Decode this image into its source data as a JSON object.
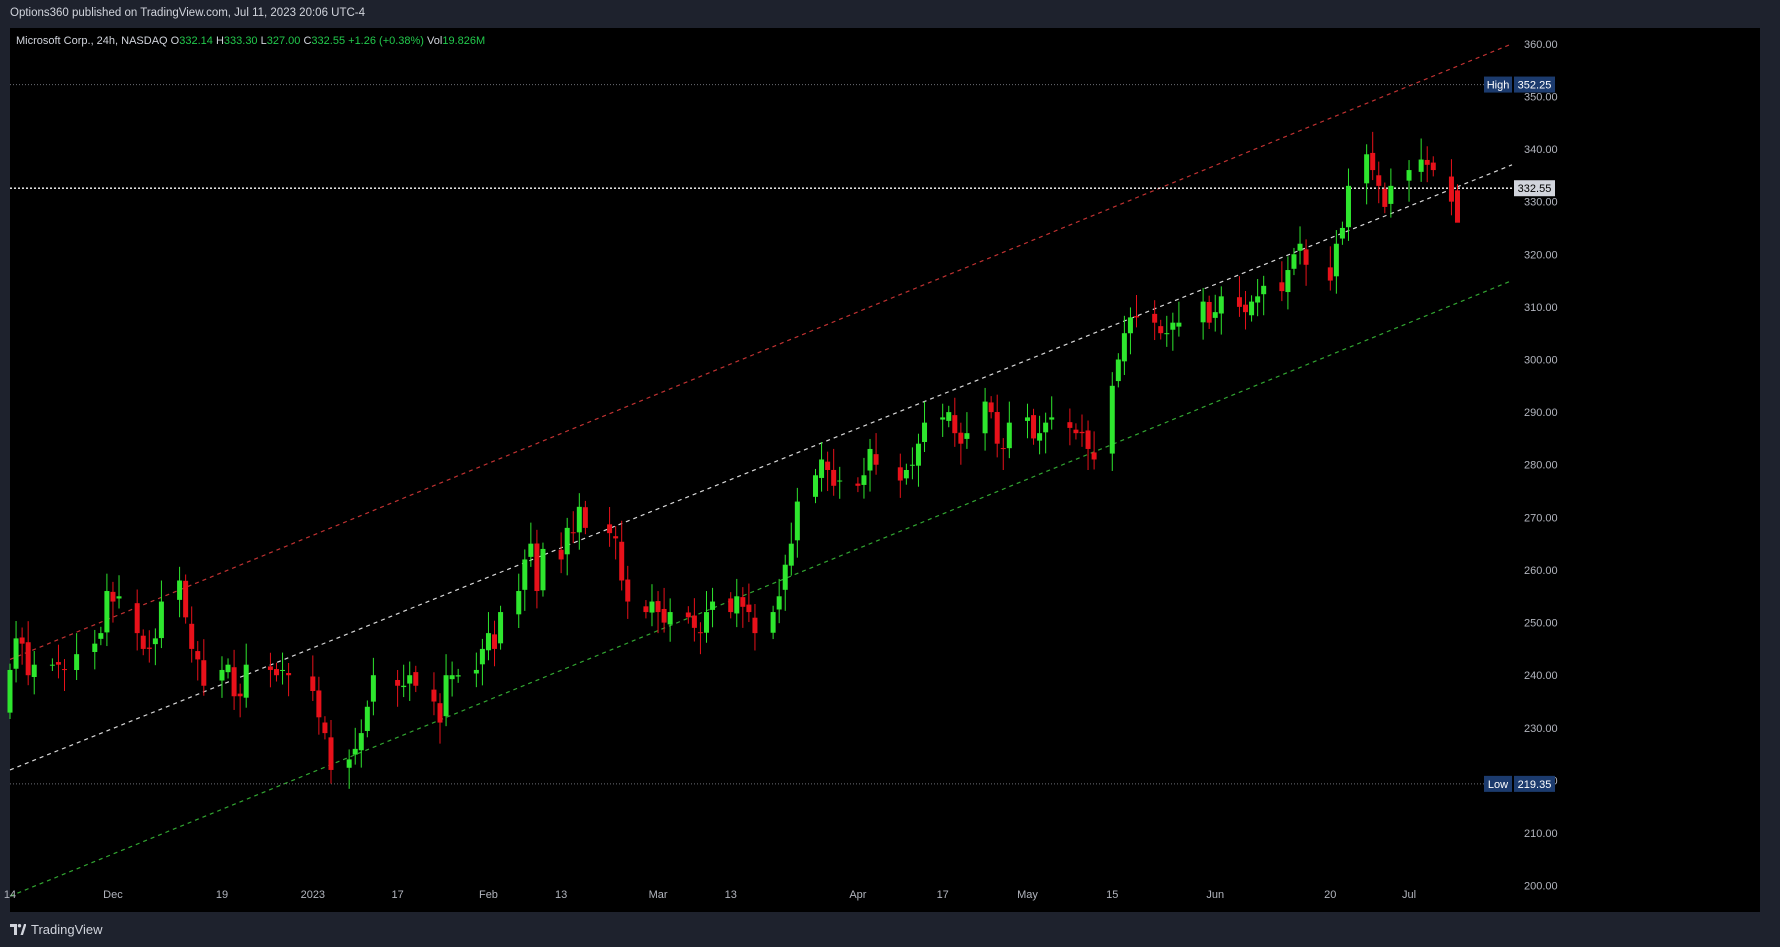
{
  "header": {
    "published": "Options360 published on TradingView.com, Jul 11, 2023 20:06 UTC-4"
  },
  "legend": {
    "symbol": "Microsoft Corp., 24h, NASDAQ",
    "open_label": "O",
    "open": "332.14",
    "high_label": "H",
    "high": "333.30",
    "low_label": "L",
    "low": "327.00",
    "close_label": "C",
    "close": "332.55",
    "change": "+1.26 (+0.38%)",
    "vol_label": "Vol",
    "volume": "19.826M"
  },
  "footer": {
    "brand": "TradingView"
  },
  "colors": {
    "up": "#2ee62e",
    "down": "#e8111a",
    "background": "#000000",
    "panel": "#1e222d",
    "axis_text": "#b2b5be",
    "upper_channel": "#e23b3b",
    "middle_channel": "#ffffff",
    "lower_channel": "#3bc43b",
    "badge": "#1c3b6e"
  },
  "chart_data": {
    "type": "candlestick",
    "title": "Microsoft Corp., 24h, NASDAQ",
    "y_axis": {
      "ticks": [
        200,
        210,
        220,
        230,
        240,
        250,
        260,
        270,
        280,
        290,
        300,
        310,
        320,
        330,
        340,
        350,
        360
      ],
      "tick_labels": [
        "200.00",
        "210.00",
        "220.00",
        "230.00",
        "240.00",
        "250.00",
        "260.00",
        "270.00",
        "280.00",
        "290.00",
        "300.00",
        "310.00",
        "320.00",
        "330.00",
        "340.00",
        "350.00",
        "360.00"
      ],
      "range": [
        195,
        363
      ]
    },
    "x_axis": {
      "start_date": "2022-11-14",
      "end_date": "2023-07-11",
      "range": [
        "2022-11-14",
        "2023-07-20"
      ],
      "ticks": [
        {
          "label": "14",
          "date": "2022-11-14"
        },
        {
          "label": "Dec",
          "date": "2022-12-01"
        },
        {
          "label": "19",
          "date": "2022-12-19"
        },
        {
          "label": "2023",
          "date": "2023-01-03"
        },
        {
          "label": "17",
          "date": "2023-01-17"
        },
        {
          "label": "Feb",
          "date": "2023-02-01"
        },
        {
          "label": "13",
          "date": "2023-02-13"
        },
        {
          "label": "Mar",
          "date": "2023-03-01"
        },
        {
          "label": "13",
          "date": "2023-03-13"
        },
        {
          "label": "Apr",
          "date": "2023-04-03"
        },
        {
          "label": "17",
          "date": "2023-04-17"
        },
        {
          "label": "May",
          "date": "2023-05-01"
        },
        {
          "label": "15",
          "date": "2023-05-15"
        },
        {
          "label": "Jun",
          "date": "2023-06-01"
        },
        {
          "label": "20",
          "date": "2023-06-20"
        },
        {
          "label": "Jul",
          "date": "2023-07-03"
        }
      ]
    },
    "close_series": [
      241,
      247,
      246,
      240,
      242,
      242,
      242,
      241,
      244,
      246,
      248,
      256,
      254,
      255,
      248,
      245,
      245,
      247,
      254,
      258,
      251,
      245,
      243,
      238,
      241,
      242,
      236,
      236,
      242,
      241,
      240,
      241,
      240,
      237,
      232,
      229,
      222,
      224,
      226,
      229,
      234,
      240,
      238,
      238,
      240,
      238,
      235,
      231,
      240,
      240,
      240,
      241,
      245,
      248,
      245,
      252,
      256,
      262,
      265,
      256,
      264,
      262,
      268,
      267,
      272,
      268,
      267,
      266,
      258,
      254,
      252,
      254,
      252,
      250,
      252,
      251,
      249,
      248,
      252,
      254,
      252,
      255,
      253,
      252,
      248,
      252,
      255,
      261,
      265,
      273,
      278,
      281,
      279,
      276,
      277,
      276,
      278,
      283,
      280,
      277,
      279,
      280,
      284,
      288,
      289,
      290,
      286,
      284,
      286,
      292,
      290,
      284,
      283,
      288,
      289,
      285,
      286,
      288,
      289,
      287,
      286,
      286,
      283,
      281,
      295,
      300,
      305,
      308,
      308,
      307,
      305,
      305,
      307,
      307,
      311,
      307,
      309,
      312,
      310,
      309,
      311,
      312,
      314,
      313,
      317,
      320,
      322,
      318,
      315,
      322,
      325,
      333,
      339,
      336,
      333,
      329,
      333,
      336,
      338,
      337,
      336,
      330,
      326,
      328,
      325,
      321,
      324,
      328,
      334,
      335,
      336,
      342,
      349,
      348,
      339,
      336,
      340,
      339,
      335,
      333,
      333,
      339,
      338,
      331,
      337,
      337,
      341,
      337,
      336,
      337,
      340,
      342,
      336,
      336,
      335,
      331,
      333
    ],
    "price_lines": [
      {
        "label": "High",
        "value": 352.25,
        "text": "352.25",
        "style": "dotted-gray"
      },
      {
        "label": "Low",
        "value": 219.35,
        "text": "219.35",
        "style": "dotted-gray"
      },
      {
        "label": "",
        "value": 332.55,
        "text": "332.55",
        "style": "dotted-white"
      }
    ],
    "trend_channel": {
      "upper": {
        "from": [
          "2022-11-14",
          243
        ],
        "to": [
          "2023-07-20",
          360
        ],
        "color": "red",
        "style": "dashed"
      },
      "middle": {
        "from": [
          "2022-11-14",
          222
        ],
        "to": [
          "2023-07-20",
          337
        ],
        "color": "white",
        "style": "dashed"
      },
      "lower": {
        "from": [
          "2022-11-14",
          198
        ],
        "to": [
          "2023-07-20",
          315
        ],
        "color": "green",
        "style": "dashed"
      }
    },
    "grid": false
  }
}
